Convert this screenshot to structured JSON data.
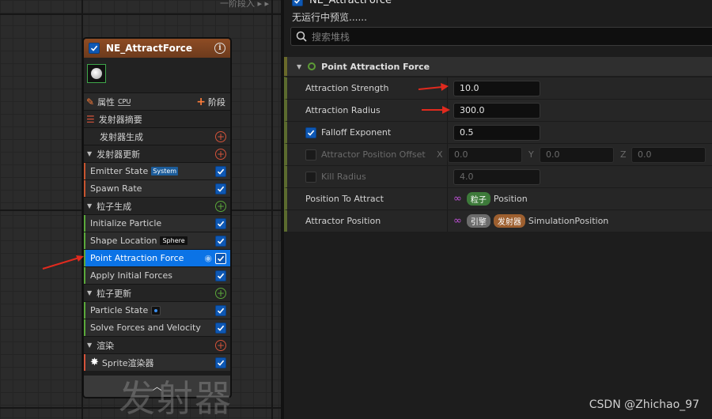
{
  "graph": {
    "top_label": "一阶段入 ▸ ▸",
    "watermark": "发射器"
  },
  "node": {
    "title": "NE_AttractForce",
    "properties_label": "属性",
    "cpu_label": "CPU",
    "stage_label": "阶段",
    "summary_label": "发射器摘要",
    "emitter_spawn": "发射器生成",
    "emitter_update": "发射器更新",
    "emitter_state": "Emitter State",
    "emitter_state_badge": "System",
    "spawn_rate": "Spawn Rate",
    "particle_spawn": "粒子生成",
    "initialize_particle": "Initialize Particle",
    "shape_location": "Shape Location",
    "shape_location_badge": "Sphere",
    "point_attraction_force": "Point Attraction Force",
    "apply_initial_forces": "Apply Initial Forces",
    "particle_update": "粒子更新",
    "particle_state": "Particle State",
    "solve_forces": "Solve Forces and Velocity",
    "render": "渲染",
    "sprite_renderer": "Sprite渲染器"
  },
  "panel": {
    "title": "NE_AttractForce",
    "subtitle": "无运行中预览......",
    "search_placeholder": "搜索堆栈",
    "section_title": "Point Attraction Force",
    "rows": [
      {
        "name": "Attraction Strength",
        "value": "10.0"
      },
      {
        "name": "Attraction Radius",
        "value": "300.0"
      },
      {
        "name": "Falloff Exponent",
        "value": "0.5"
      },
      {
        "name": "Attractor Position Offset",
        "x": "0.0",
        "y": "0.0",
        "z": "0.0",
        "x_label": "X",
        "y_label": "Y",
        "z_label": "Z"
      },
      {
        "name": "Kill Radius",
        "value": "4.0"
      },
      {
        "name": "Position To Attract",
        "pill": "粒子",
        "text": "Position"
      },
      {
        "name": "Attractor Position",
        "pill1": "引擎",
        "pill2": "发射器",
        "text": "SimulationPosition"
      }
    ]
  },
  "credit": "CSDN @Zhichao_97",
  "colors": {
    "accent_blue": "#0b73e6",
    "node_header": "#8e4c24",
    "arrow_red": "#e02a1e"
  }
}
